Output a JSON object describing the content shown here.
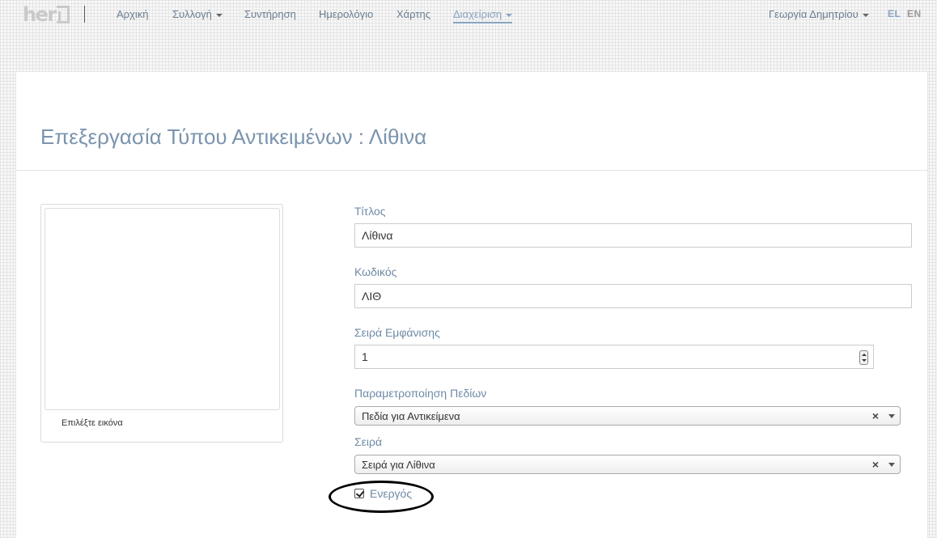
{
  "navbar": {
    "logo_text": "her",
    "items": [
      {
        "label": "Αρχική",
        "dropdown": false
      },
      {
        "label": "Συλλογή",
        "dropdown": true
      },
      {
        "label": "Συντήρηση",
        "dropdown": false
      },
      {
        "label": "Ημερολόγιο",
        "dropdown": false
      },
      {
        "label": "Χάρτης",
        "dropdown": false
      },
      {
        "label": "Διαχείριση",
        "dropdown": true,
        "active": true
      }
    ],
    "user": "Γεωργία Δημητρίου",
    "languages": [
      "EL",
      "EN"
    ],
    "active_language": "EL"
  },
  "page": {
    "title": "Επεξεργασία Τύπου Αντικειμένων : Λίθινα"
  },
  "image_card": {
    "label": "Επιλέξτε εικόνα"
  },
  "form": {
    "title": {
      "label": "Τίτλος",
      "value": "Λίθινα"
    },
    "code": {
      "label": "Κωδικός",
      "value": "ΛΙΘ"
    },
    "display_order": {
      "label": "Σειρά Εμφάνισης",
      "value": "1"
    },
    "field_config": {
      "label": "Παραμετροποίηση Πεδίων",
      "value": "Πεδία για Αντικείμενα"
    },
    "series": {
      "label": "Σειρά",
      "value": "Σειρά για Λίθινα"
    },
    "active": {
      "label": "Ενεργός",
      "checked": true
    }
  },
  "colors": {
    "accent": "#8aa4c2",
    "label": "#6e8aa6",
    "title": "#7b94ae"
  },
  "icons": {
    "clear": "×",
    "logo_box": "logo-box-icon"
  }
}
